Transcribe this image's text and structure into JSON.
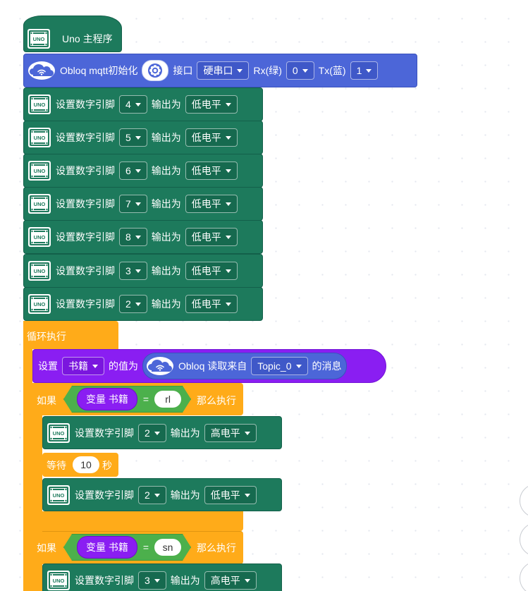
{
  "hat": {
    "label": "Uno 主程序",
    "icon": "uno-board-icon"
  },
  "obloq_init": {
    "label": "Obloq mqtt初始化",
    "port_label": "接口",
    "port_value": "硬串口",
    "rx_label": "Rx(绿)",
    "rx_value": "0",
    "tx_label": "Tx(蓝)",
    "tx_value": "1",
    "icon": "cloud-wifi-icon",
    "settings_icon": "gear-icon"
  },
  "pin_label": "设置数字引脚",
  "output_label": "输出为",
  "setup_pins": [
    {
      "pin": "4",
      "level": "低电平"
    },
    {
      "pin": "5",
      "level": "低电平"
    },
    {
      "pin": "6",
      "level": "低电平"
    },
    {
      "pin": "7",
      "level": "低电平"
    },
    {
      "pin": "8",
      "level": "低电平"
    },
    {
      "pin": "3",
      "level": "低电平"
    },
    {
      "pin": "2",
      "level": "低电平"
    }
  ],
  "loop": {
    "label": "循环执行"
  },
  "set_var": {
    "set_label": "设置",
    "var_name": "书籍",
    "value_label": "的值为",
    "reporter_label": "Obloq 读取来自",
    "topic": "Topic_0",
    "message_label": "的消息"
  },
  "if1": {
    "if_label": "如果",
    "var_label": "变量 书籍",
    "eq": "=",
    "compare": "rl",
    "then_label": "那么执行",
    "pin1": {
      "pin": "2",
      "level": "高电平"
    },
    "wait_label": "等待",
    "wait_value": "10",
    "wait_unit": "秒",
    "pin2": {
      "pin": "2",
      "level": "低电平"
    }
  },
  "if2": {
    "if_label": "如果",
    "var_label": "变量 书籍",
    "eq": "=",
    "compare": "sn",
    "then_label": "那么执行",
    "pin1": {
      "pin": "3",
      "level": "高电平"
    }
  },
  "colors": {
    "arduino_green": "#1d7a5c",
    "obloq_blue": "#4c66d8",
    "variable_purple": "#8a1ef2",
    "control_orange": "#ffab19",
    "operator_green": "#4cb04c"
  }
}
